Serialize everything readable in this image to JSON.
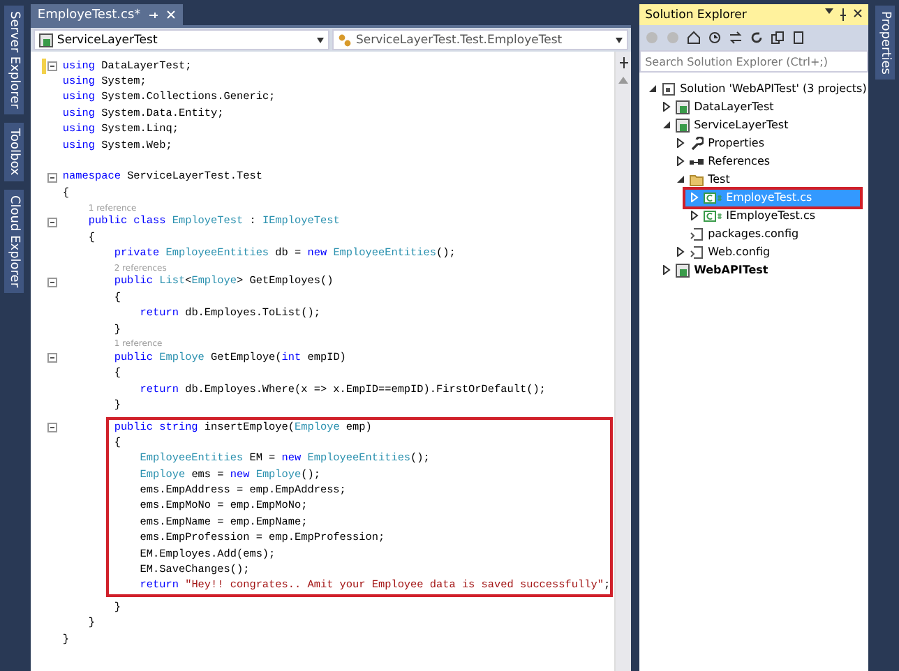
{
  "left_strip": {
    "tabs": [
      "Server Explorer",
      "Toolbox",
      "Cloud Explorer"
    ]
  },
  "editor": {
    "tab": {
      "label": "EmployeTest.cs*",
      "selected": true
    },
    "nav": {
      "project": "ServiceLayerTest",
      "member": "ServiceLayerTest.Test.EmployeTest"
    },
    "blocks": [
      {
        "lines": [
          {
            "kind": "code",
            "fold": true,
            "changed": true,
            "tokens": [
              {
                "kind": "kw",
                "s": "using "
              },
              {
                "kind": "plain",
                "s": "DataLayerTest;"
              }
            ]
          },
          {
            "kind": "code",
            "tokens": [
              {
                "kind": "kw",
                "s": "using "
              },
              {
                "kind": "plain",
                "s": "System;"
              }
            ]
          },
          {
            "kind": "code",
            "tokens": [
              {
                "kind": "kw",
                "s": "using "
              },
              {
                "kind": "plain",
                "s": "System.Collections.Generic;"
              }
            ]
          },
          {
            "kind": "code",
            "tokens": [
              {
                "kind": "kw",
                "s": "using "
              },
              {
                "kind": "plain",
                "s": "System.Data.Entity;"
              }
            ]
          },
          {
            "kind": "code",
            "tokens": [
              {
                "kind": "kw",
                "s": "using "
              },
              {
                "kind": "plain",
                "s": "System.Linq;"
              }
            ]
          },
          {
            "kind": "code",
            "tokens": [
              {
                "kind": "kw",
                "s": "using "
              },
              {
                "kind": "plain",
                "s": "System.Web;"
              }
            ]
          },
          {
            "kind": "blank"
          },
          {
            "kind": "code",
            "fold": true,
            "tokens": [
              {
                "kind": "kw",
                "s": "namespace "
              },
              {
                "kind": "plain",
                "s": "ServiceLayerTest.Test"
              }
            ]
          },
          {
            "kind": "code",
            "tokens": [
              {
                "kind": "plain",
                "s": "{"
              }
            ]
          },
          {
            "kind": "ref",
            "text": "1 reference"
          },
          {
            "kind": "code",
            "fold": true,
            "tokens": [
              {
                "kind": "kw",
                "s": "    public class "
              },
              {
                "kind": "type",
                "s": "EmployeTest"
              },
              {
                "kind": "plain",
                "s": " : "
              },
              {
                "kind": "type",
                "s": "IEmployeTest"
              }
            ]
          },
          {
            "kind": "code",
            "tokens": [
              {
                "kind": "plain",
                "s": "    {"
              }
            ]
          },
          {
            "kind": "code",
            "tokens": [
              {
                "kind": "kw",
                "s": "        private "
              },
              {
                "kind": "type",
                "s": "EmployeeEntities"
              },
              {
                "kind": "plain",
                "s": " db = "
              },
              {
                "kind": "kw",
                "s": "new "
              },
              {
                "kind": "type",
                "s": "EmployeeEntities"
              },
              {
                "kind": "plain",
                "s": "();"
              }
            ]
          },
          {
            "kind": "ref",
            "text": "2 references"
          },
          {
            "kind": "code",
            "fold": true,
            "tokens": [
              {
                "kind": "kw",
                "s": "        public "
              },
              {
                "kind": "type",
                "s": "List"
              },
              {
                "kind": "plain",
                "s": "<"
              },
              {
                "kind": "type",
                "s": "Employe"
              },
              {
                "kind": "plain",
                "s": "> GetEmployes()"
              }
            ]
          },
          {
            "kind": "code",
            "tokens": [
              {
                "kind": "plain",
                "s": "        {"
              }
            ]
          },
          {
            "kind": "code",
            "tokens": [
              {
                "kind": "kw",
                "s": "            return "
              },
              {
                "kind": "plain",
                "s": "db.Employes.ToList();"
              }
            ]
          },
          {
            "kind": "code",
            "tokens": [
              {
                "kind": "plain",
                "s": "        }"
              }
            ]
          },
          {
            "kind": "ref",
            "text": "1 reference"
          },
          {
            "kind": "code",
            "fold": true,
            "tokens": [
              {
                "kind": "kw",
                "s": "        public "
              },
              {
                "kind": "type",
                "s": "Employe"
              },
              {
                "kind": "plain",
                "s": " GetEmploye("
              },
              {
                "kind": "kw",
                "s": "int"
              },
              {
                "kind": "plain",
                "s": " empID)"
              }
            ]
          },
          {
            "kind": "code",
            "tokens": [
              {
                "kind": "plain",
                "s": "        {"
              }
            ]
          },
          {
            "kind": "code",
            "tokens": [
              {
                "kind": "kw",
                "s": "            return "
              },
              {
                "kind": "plain",
                "s": "db.Employes.Where(x => x.EmpID==empID).FirstOrDefault();"
              }
            ]
          },
          {
            "kind": "code",
            "tokens": [
              {
                "kind": "plain",
                "s": "        }"
              }
            ]
          }
        ]
      },
      {
        "annotated": true,
        "lines": [
          {
            "kind": "code",
            "fold": true,
            "tokens": [
              {
                "kind": "kw",
                "s": "        public string "
              },
              {
                "kind": "plain",
                "s": "insertEmploye("
              },
              {
                "kind": "type",
                "s": "Employe"
              },
              {
                "kind": "plain",
                "s": " emp)"
              }
            ]
          },
          {
            "kind": "code",
            "tokens": [
              {
                "kind": "plain",
                "s": "        {"
              }
            ]
          },
          {
            "kind": "code",
            "tokens": [
              {
                "kind": "type",
                "s": "            EmployeeEntities"
              },
              {
                "kind": "plain",
                "s": " EM = "
              },
              {
                "kind": "kw",
                "s": "new "
              },
              {
                "kind": "type",
                "s": "EmployeeEntities"
              },
              {
                "kind": "plain",
                "s": "();"
              }
            ]
          },
          {
            "kind": "code",
            "tokens": [
              {
                "kind": "type",
                "s": "            Employe"
              },
              {
                "kind": "plain",
                "s": " ems = "
              },
              {
                "kind": "kw",
                "s": "new "
              },
              {
                "kind": "type",
                "s": "Employe"
              },
              {
                "kind": "plain",
                "s": "();"
              }
            ]
          },
          {
            "kind": "code",
            "tokens": [
              {
                "kind": "plain",
                "s": "            ems.EmpAddress = emp.EmpAddress;"
              }
            ]
          },
          {
            "kind": "code",
            "tokens": [
              {
                "kind": "plain",
                "s": "            ems.EmpMoNo = emp.EmpMoNo;"
              }
            ]
          },
          {
            "kind": "code",
            "tokens": [
              {
                "kind": "plain",
                "s": "            ems.EmpName = emp.EmpName;"
              }
            ]
          },
          {
            "kind": "code",
            "tokens": [
              {
                "kind": "plain",
                "s": "            ems.EmpProfession = emp.EmpProfession;"
              }
            ]
          },
          {
            "kind": "code",
            "tokens": [
              {
                "kind": "plain",
                "s": "            EM.Employes.Add(ems);"
              }
            ]
          },
          {
            "kind": "code",
            "tokens": [
              {
                "kind": "plain",
                "s": "            EM.SaveChanges();"
              }
            ]
          },
          {
            "kind": "code",
            "tokens": [
              {
                "kind": "kw",
                "s": "            return "
              },
              {
                "kind": "str",
                "s": "\"Hey!! congrates.. Amit your Employee data is saved successfully\""
              },
              {
                "kind": "plain",
                "s": ";"
              }
            ]
          }
        ]
      },
      {
        "lines": [
          {
            "kind": "code",
            "tokens": [
              {
                "kind": "plain",
                "s": "        }"
              }
            ]
          },
          {
            "kind": "code",
            "tokens": [
              {
                "kind": "plain",
                "s": "    }"
              }
            ]
          },
          {
            "kind": "code",
            "tokens": [
              {
                "kind": "plain",
                "s": "}"
              }
            ]
          }
        ]
      }
    ]
  },
  "solution_explorer": {
    "title": "Solution Explorer",
    "search": {
      "placeholder": "Search Solution Explorer (Ctrl+;)"
    },
    "tree": [
      {
        "label": "Solution 'WebAPITest' (3 projects)",
        "kind": "solution",
        "expanded": true,
        "selected": false,
        "bold": false,
        "children": [
          {
            "label": "DataLayerTest",
            "kind": "project",
            "expanded": false,
            "selected": false,
            "bold": false
          },
          {
            "label": "ServiceLayerTest",
            "kind": "project",
            "expanded": true,
            "selected": false,
            "bold": false,
            "children": [
              {
                "label": "Properties",
                "kind": "properties",
                "expanded": false,
                "selected": false,
                "bold": false
              },
              {
                "label": "References",
                "kind": "references",
                "expanded": false,
                "selected": false,
                "bold": false
              },
              {
                "label": "Test",
                "kind": "folder",
                "expanded": true,
                "selected": false,
                "bold": false,
                "children": [
                  {
                    "label": "EmployeTest.cs",
                    "kind": "csfile",
                    "expanded": false,
                    "selected": true,
                    "bold": false,
                    "annotated": true
                  },
                  {
                    "label": "IEmployeTest.cs",
                    "kind": "csfile",
                    "expanded": false,
                    "selected": false,
                    "bold": false
                  }
                ]
              },
              {
                "label": "packages.config",
                "kind": "config",
                "selected": false,
                "bold": false
              },
              {
                "label": "Web.config",
                "kind": "config",
                "expanded": false,
                "selected": false,
                "bold": false
              }
            ]
          },
          {
            "label": "WebAPITest",
            "kind": "project",
            "expanded": false,
            "selected": false,
            "bold": true
          }
        ]
      }
    ]
  },
  "right_strip": {
    "tabs": [
      "Properties"
    ]
  }
}
